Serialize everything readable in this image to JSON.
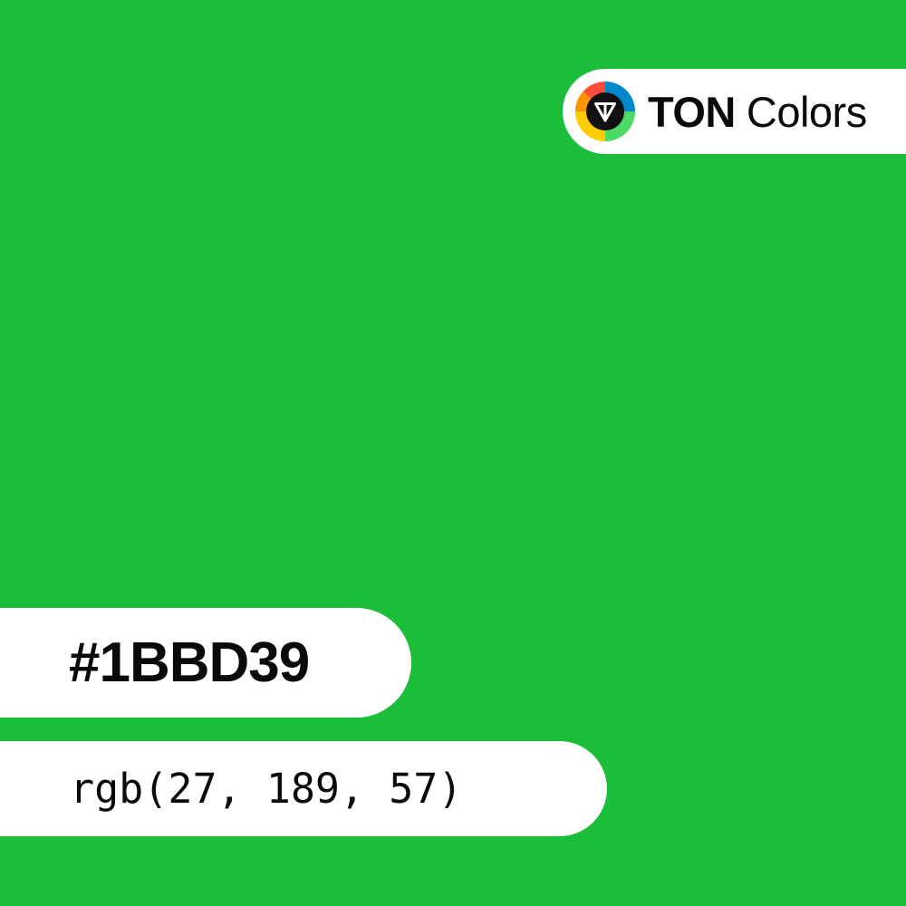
{
  "swatch": {
    "color": "#1BBD39"
  },
  "brand": {
    "name_strong": "TON",
    "name_light": "Colors",
    "logo_icon": "ton-colors-logo-icon",
    "logo_colors": [
      "#FF4B3A",
      "#0088CC",
      "#4CD964",
      "#FFCC00",
      "#FF9500"
    ]
  },
  "color_info": {
    "hex": "#1BBD39",
    "rgb": "rgb(27, 189, 57)"
  }
}
